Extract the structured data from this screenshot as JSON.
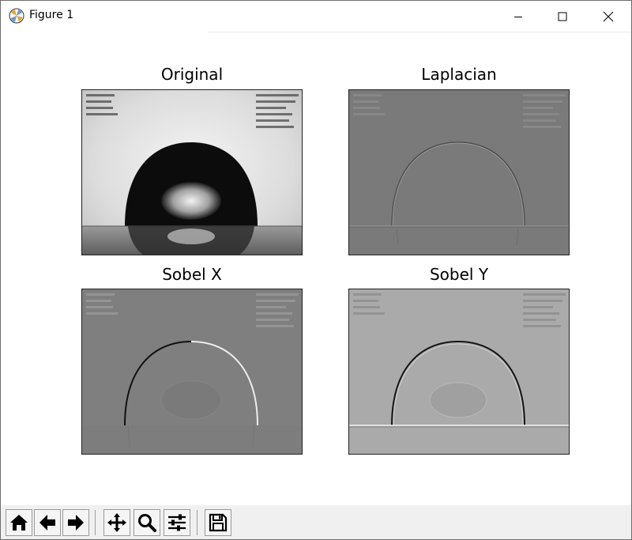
{
  "window": {
    "title": "Figure 1"
  },
  "titlebar_buttons": {
    "minimize": "minimize-icon",
    "maximize": "maximize-icon",
    "close": "close-icon"
  },
  "figure": {
    "panels": [
      {
        "title": "Original",
        "image": "grayscale photograph of a sessile water droplet on a surface with overlay measurement text"
      },
      {
        "title": "Laplacian",
        "image": "Laplacian edge-filtered droplet image"
      },
      {
        "title": "Sobel X",
        "image": "Sobel X gradient droplet image"
      },
      {
        "title": "Sobel Y",
        "image": "Sobel Y gradient droplet image"
      }
    ]
  },
  "toolbar": {
    "buttons": [
      {
        "name": "home",
        "icon": "home-icon"
      },
      {
        "name": "back",
        "icon": "arrow-left-icon"
      },
      {
        "name": "forward",
        "icon": "arrow-right-icon"
      },
      {
        "name": "pan",
        "icon": "move-icon"
      },
      {
        "name": "zoom",
        "icon": "magnifier-icon"
      },
      {
        "name": "configure-subplots",
        "icon": "sliders-icon"
      },
      {
        "name": "save",
        "icon": "floppy-disk-icon"
      }
    ]
  }
}
